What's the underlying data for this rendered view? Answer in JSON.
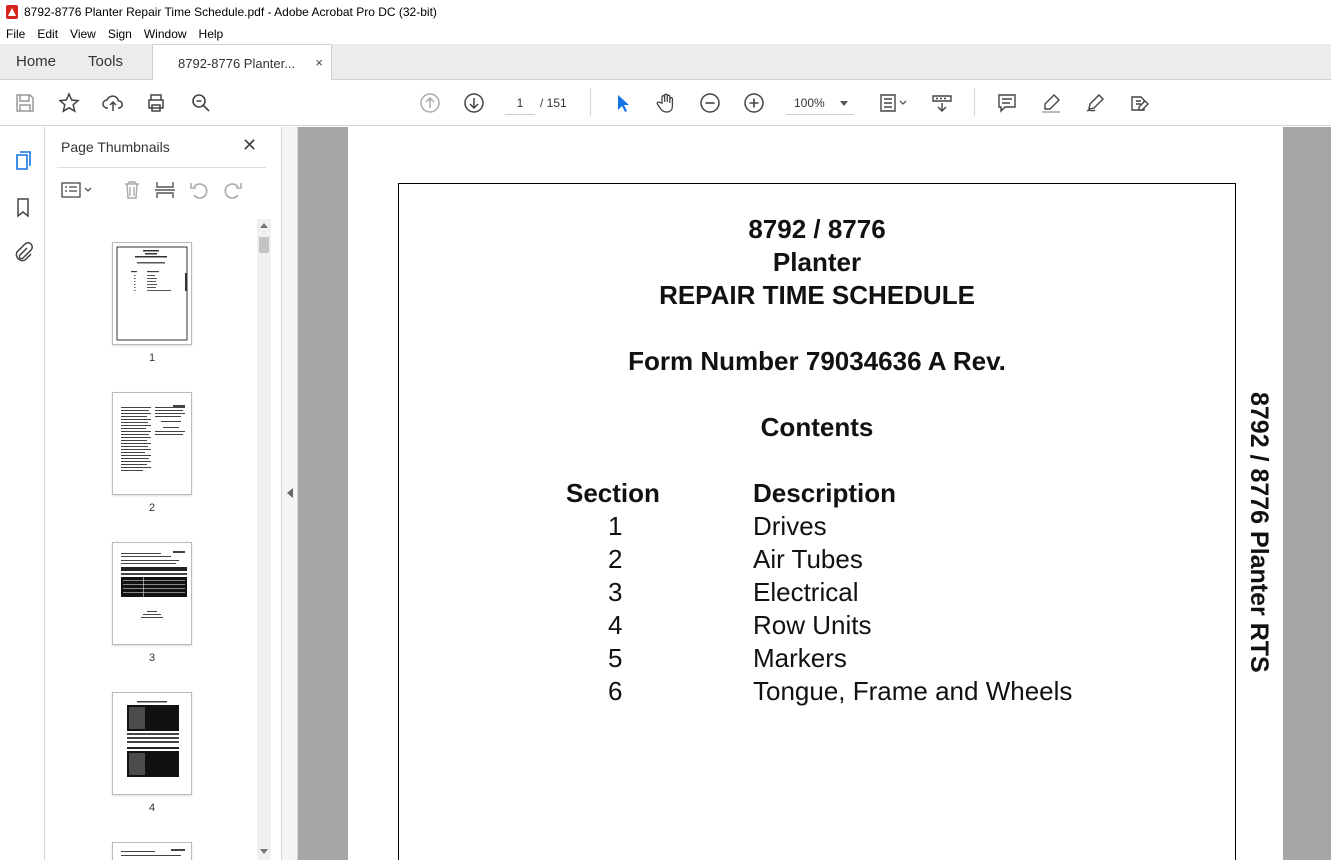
{
  "window": {
    "title": "8792-8776 Planter Repair Time Schedule.pdf - Adobe Acrobat Pro DC (32-bit)"
  },
  "menu": {
    "items": [
      "File",
      "Edit",
      "View",
      "Sign",
      "Window",
      "Help"
    ]
  },
  "tabs": {
    "home": "Home",
    "tools": "Tools",
    "document": "8792-8776 Planter...",
    "close": "×"
  },
  "toolbar": {
    "current_page": "1",
    "total_pages": "/ 151",
    "zoom": "100%"
  },
  "thumbnails": {
    "title": "Page Thumbnails",
    "close": "✕",
    "pages": [
      "1",
      "2",
      "3",
      "4"
    ]
  },
  "document": {
    "line1": "8792 / 8776",
    "line2": "Planter",
    "line3": "REPAIR TIME SCHEDULE",
    "form": "Form Number 79034636 A Rev.",
    "contents": "Contents",
    "col_section": "Section",
    "col_description": "Description",
    "rows": [
      {
        "section": "1",
        "description": "Drives"
      },
      {
        "section": "2",
        "description": "Air Tubes"
      },
      {
        "section": "3",
        "description": "Electrical"
      },
      {
        "section": "4",
        "description": "Row Units"
      },
      {
        "section": "5",
        "description": "Markers"
      },
      {
        "section": "6",
        "description": "Tongue, Frame and Wheels"
      }
    ],
    "side_label": "8792 / 8776 Planter RTS"
  },
  "colors": {
    "accent_blue": "#1473e6",
    "pdf_red": "#d7261e",
    "canvas_gray": "#a6a6a6"
  }
}
